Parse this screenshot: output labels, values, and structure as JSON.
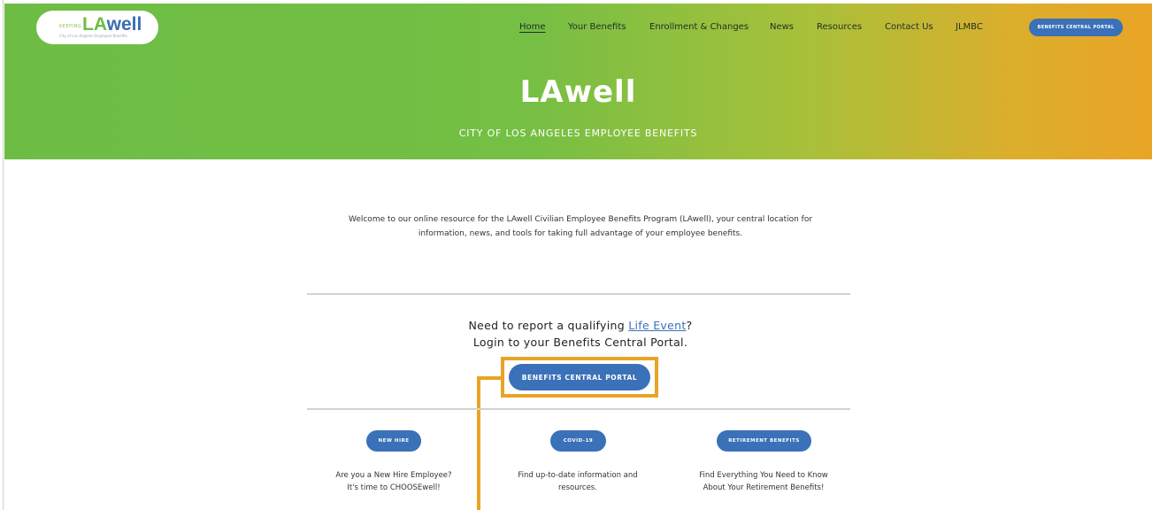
{
  "logo": {
    "small": "KEEPING",
    "la": "LA",
    "well": "well",
    "sub": "City of Los Angeles Employee Benefits"
  },
  "nav": {
    "items": [
      {
        "label": "Home"
      },
      {
        "label": "Your Benefits"
      },
      {
        "label": "Enrollment & Changes"
      },
      {
        "label": "News"
      },
      {
        "label": "Resources"
      },
      {
        "label": "Contact Us"
      },
      {
        "label": "JLMBC"
      }
    ],
    "portal_button": "BENEFITS CENTRAL PORTAL"
  },
  "hero": {
    "title": "LAwell",
    "subtitle": "CITY OF LOS ANGELES EMPLOYEE BENEFITS"
  },
  "welcome": {
    "line1": "Welcome to our online resource for the LAwell Civilian Employee Benefits Program (LAwell), your central location for",
    "line2": "information, news, and tools for taking full advantage of your employee benefits."
  },
  "cta": {
    "prefix": "Need to report a qualifying ",
    "link": "Life Event",
    "suffix": "?",
    "line2": "Login to your Benefits Central Portal.",
    "button": "BENEFITS CENTRAL PORTAL"
  },
  "cards": [
    {
      "button": "NEW HIRE",
      "line1": "Are you a New Hire Employee?",
      "line2": "It's time to CHOOSEwell!"
    },
    {
      "button": "COVID-19",
      "line1": "Find up-to-date information and",
      "line2": "resources."
    },
    {
      "button": "RETIREMENT BENEFITS",
      "line1": "Find Everything You Need to Know",
      "line2": "About Your Retirement Benefits!"
    }
  ],
  "colors": {
    "accent_blue": "#3a71b8",
    "highlight_orange": "#e9a426",
    "brand_green": "#6dbd45"
  }
}
